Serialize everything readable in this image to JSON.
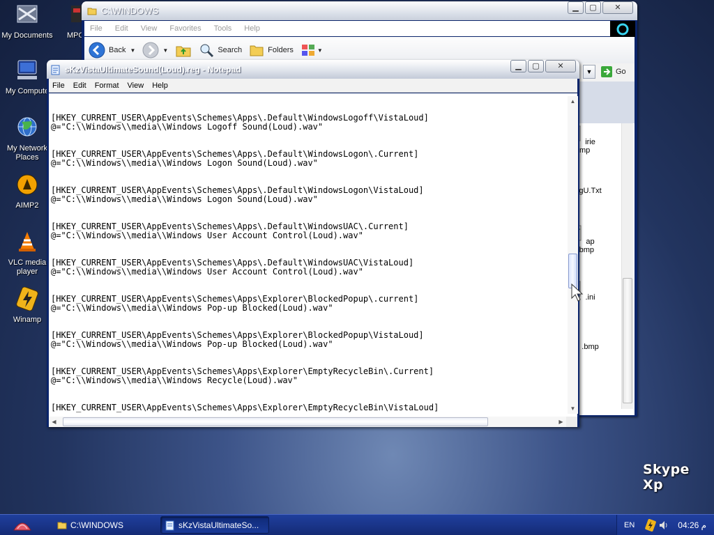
{
  "desktop": {
    "icons": [
      {
        "label": "My Documents"
      },
      {
        "label": "MPC"
      },
      {
        "label": "My Compute"
      },
      {
        "label": "My Network Places"
      },
      {
        "label": "AIMP2"
      },
      {
        "label": "VLC media player"
      },
      {
        "label": "Winamp"
      }
    ],
    "watermark": "Skype Xp"
  },
  "explorer": {
    "title": "C:\\WINDOWS",
    "menu": [
      "File",
      "Edit",
      "View",
      "Favorites",
      "Tools",
      "Help"
    ],
    "toolbar": {
      "back": "Back",
      "search": "Search",
      "folders": "Folders"
    },
    "go_label": "Go",
    "files": [
      "irie .bmp",
      "gU.Txt",
      "ap es.bmp",
      ".ini",
      ".bmp"
    ]
  },
  "notepad": {
    "title": "sKzVistaUltimateSound(Loud).reg - Notepad",
    "menu": [
      "File",
      "Edit",
      "Format",
      "View",
      "Help"
    ],
    "content": "\n\n[HKEY_CURRENT_USER\\AppEvents\\Schemes\\Apps\\.Default\\WindowsLogoff\\VistaLoud]\n@=\"C:\\\\Windows\\\\media\\\\Windows Logoff Sound(Loud).wav\"\n\n\n[HKEY_CURRENT_USER\\AppEvents\\Schemes\\Apps\\.Default\\WindowsLogon\\.Current]\n@=\"C:\\\\Windows\\\\media\\\\Windows Logon Sound(Loud).wav\"\n\n\n[HKEY_CURRENT_USER\\AppEvents\\Schemes\\Apps\\.Default\\WindowsLogon\\VistaLoud]\n@=\"C:\\\\Windows\\\\media\\\\Windows Logon Sound(Loud).wav\"\n\n\n[HKEY_CURRENT_USER\\AppEvents\\Schemes\\Apps\\.Default\\WindowsUAC\\.Current]\n@=\"C:\\\\Windows\\\\media\\\\Windows User Account Control(Loud).wav\"\n\n\n[HKEY_CURRENT_USER\\AppEvents\\Schemes\\Apps\\.Default\\WindowsUAC\\VistaLoud]\n@=\"C:\\\\Windows\\\\media\\\\Windows User Account Control(Loud).wav\"\n\n\n[HKEY_CURRENT_USER\\AppEvents\\Schemes\\Apps\\Explorer\\BlockedPopup\\.current]\n@=\"C:\\\\Windows\\\\media\\\\Windows Pop-up Blocked(Loud).wav\"\n\n\n[HKEY_CURRENT_USER\\AppEvents\\Schemes\\Apps\\Explorer\\BlockedPopup\\VistaLoud]\n@=\"C:\\\\Windows\\\\media\\\\Windows Pop-up Blocked(Loud).wav\"\n\n\n[HKEY_CURRENT_USER\\AppEvents\\Schemes\\Apps\\Explorer\\EmptyRecycleBin\\.Current]\n@=\"C:\\\\Windows\\\\media\\\\Windows Recycle(Loud).wav\"\n\n\n[HKEY_CURRENT_USER\\AppEvents\\Schemes\\Apps\\Explorer\\EmptyRecycleBin\\VistaLoud]"
  },
  "taskbar": {
    "tasks": [
      {
        "label": "C:\\WINDOWS"
      },
      {
        "label": "sKzVistaUltimateSo..."
      }
    ],
    "tray": {
      "language": "EN",
      "clock": "04:26 ‏م"
    }
  }
}
